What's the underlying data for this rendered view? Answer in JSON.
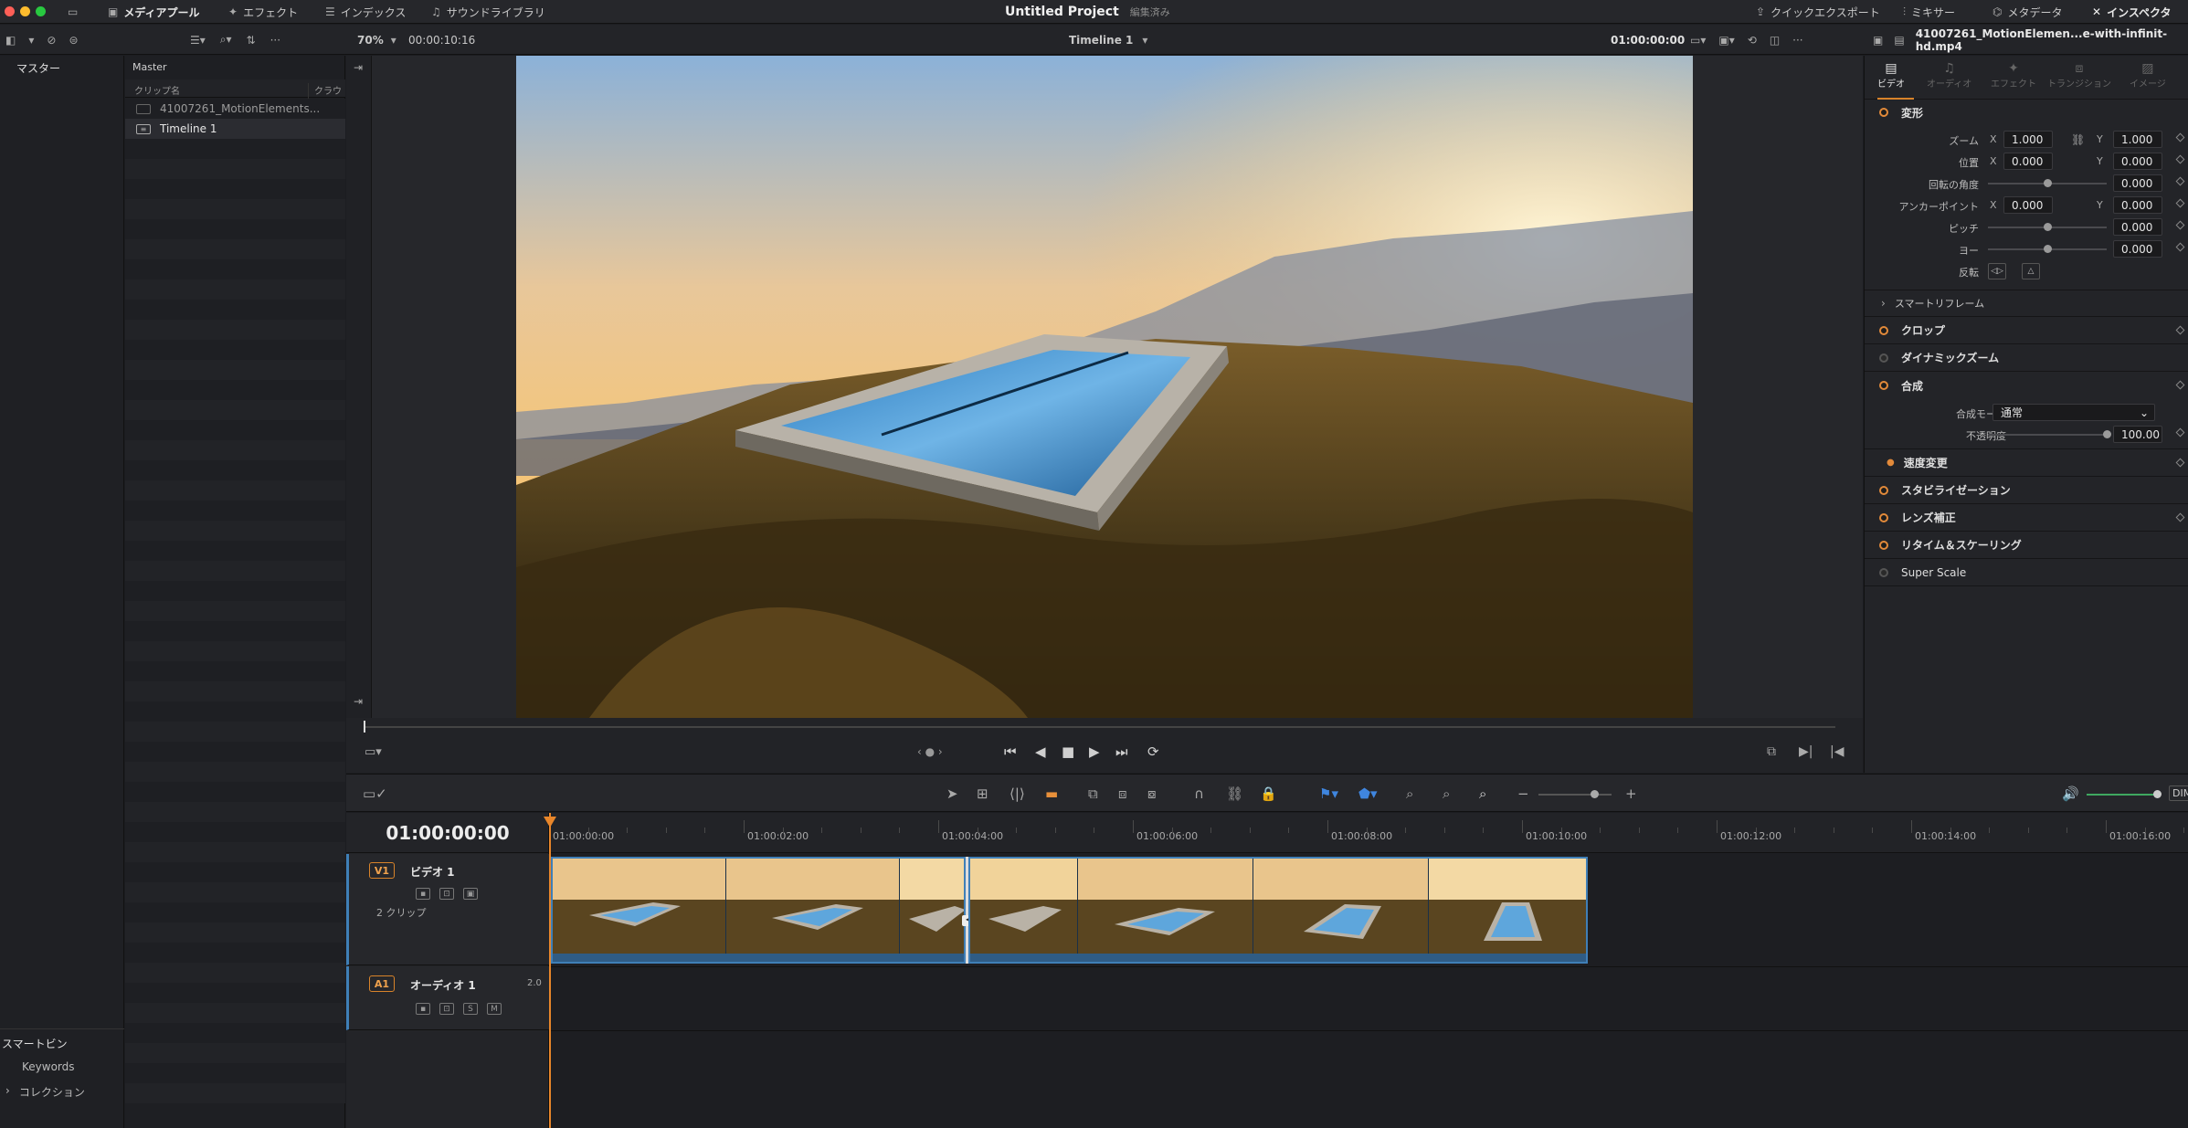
{
  "menu": {
    "media_pool": "メディアプール",
    "effects": "エフェクト",
    "index": "インデックス",
    "sound_library": "サウンドライブラリ",
    "quick_export": "クイックエクスポート",
    "mixer": "ミキサー",
    "metadata": "メタデータ",
    "inspector": "インスペクタ"
  },
  "project": {
    "title": "Untitled Project",
    "status": "編集済み"
  },
  "viewer_bar": {
    "zoom": "70%",
    "timecode": "00:00:10:16",
    "timeline_name": "Timeline 1",
    "current_tc": "01:00:00:00",
    "clip_name": "41007261_MotionElemen...e-with-infinit-hd.mp4"
  },
  "bins": {
    "master": "マスター",
    "smart_bins": "スマートビン",
    "keywords": "Keywords",
    "collections": "コレクション"
  },
  "pool": {
    "title": "Master",
    "col_clipname": "クリップ名",
    "col_credit": "クラウド",
    "items": [
      {
        "name": "41007261_MotionElements..."
      },
      {
        "name": "Timeline 1"
      }
    ]
  },
  "inspector": {
    "tabs": [
      "ビデオ",
      "オーディオ",
      "エフェクト",
      "トランジション",
      "イメージ"
    ],
    "transform": "変形",
    "zoom_label": "ズーム",
    "zoom_x": "1.000",
    "zoom_y": "1.000",
    "position_label": "位置",
    "pos_x": "0.000",
    "pos_y": "0.000",
    "rotation_label": "回転の角度",
    "rotation": "0.000",
    "anchor_label": "アンカーポイント",
    "anchor_x": "0.000",
    "anchor_y": "0.000",
    "pitch_label": "ピッチ",
    "pitch": "0.000",
    "yaw_label": "ヨー",
    "yaw": "0.000",
    "flip_label": "反転",
    "smart_reframe": "スマートリフレーム",
    "crop": "クロップ",
    "dynamic_zoom": "ダイナミックズーム",
    "composite": "合成",
    "composite_mode_label": "合成モード",
    "composite_mode": "通常",
    "opacity_label": "不透明度",
    "opacity": "100.00",
    "speed_change": "速度変更",
    "stabilization": "スタビライゼーション",
    "lens_correction": "レンズ補正",
    "retime_scaling": "リタイム＆スケーリング",
    "super_scale": "Super Scale",
    "axis_x": "X",
    "axis_y": "Y"
  },
  "timeline": {
    "timecode": "01:00:00:00",
    "ruler": [
      "01:00:00:00",
      "01:00:02:00",
      "01:00:04:00",
      "01:00:06:00",
      "01:00:08:00",
      "01:00:10:00",
      "01:00:12:00",
      "01:00:14:00",
      "01:00:16:00"
    ],
    "v1": {
      "badge": "V1",
      "name": "ビデオ 1",
      "clips": "2 クリップ"
    },
    "a1": {
      "badge": "A1",
      "name": "オーディオ 1",
      "channels": "2.0",
      "solo": "S",
      "mute": "M"
    },
    "dim": "DIM"
  }
}
